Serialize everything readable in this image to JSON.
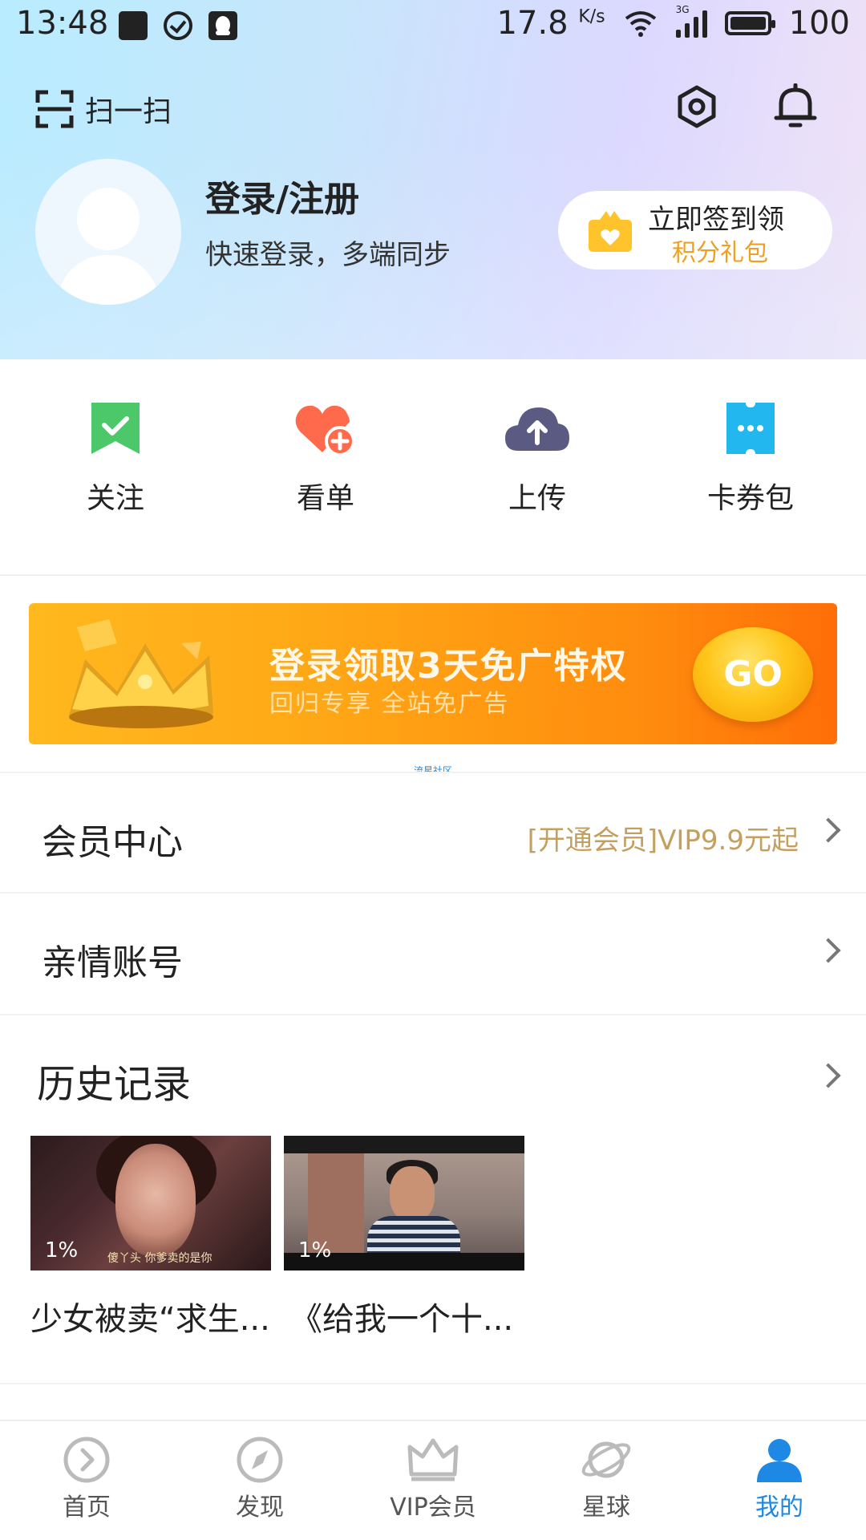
{
  "status_bar": {
    "time": "13:48",
    "speed": "17.8",
    "speed_unit": "K/s",
    "network_label": "3G",
    "battery": "100"
  },
  "header": {
    "scan_label": "扫一扫",
    "settings_icon": "settings-icon",
    "bell_icon": "bell-icon"
  },
  "profile": {
    "title": "登录/注册",
    "subtitle": "快速登录，多端同步",
    "signin_line1": "立即签到领",
    "signin_line2": "积分礼包"
  },
  "actions": [
    {
      "label": "关注",
      "icon": "bookmark-check-icon",
      "color": "#4cc76a"
    },
    {
      "label": "看单",
      "icon": "heart-plus-icon",
      "color": "#ff6a4d"
    },
    {
      "label": "上传",
      "icon": "cloud-upload-icon",
      "color": "#5b5a82"
    },
    {
      "label": "卡券包",
      "icon": "ticket-icon",
      "color": "#22b7ee"
    }
  ],
  "banner": {
    "title": "登录领取3天免广特权",
    "subtitle": "回归专享 全站免广告",
    "button": "GO",
    "credit": "流星社区"
  },
  "rows": [
    {
      "title": "会员中心",
      "extra": "[开通会员]VIP9.9元起"
    },
    {
      "title": "亲情账号",
      "extra": ""
    }
  ],
  "history": {
    "title": "历史记录",
    "items": [
      {
        "title": "少女被卖“求生...",
        "progress": "1%",
        "caption": "傻丫头 你爹卖的是你"
      },
      {
        "title": "《给我一个十...",
        "progress": "1%",
        "caption": ""
      }
    ]
  },
  "tabs": [
    {
      "label": "首页",
      "icon": "play-circle-icon",
      "active": false
    },
    {
      "label": "发现",
      "icon": "compass-icon",
      "active": false
    },
    {
      "label": "VIP会员",
      "icon": "crown-icon",
      "active": false
    },
    {
      "label": "星球",
      "icon": "planet-icon",
      "active": false
    },
    {
      "label": "我的",
      "icon": "person-icon",
      "active": true
    }
  ],
  "colors": {
    "accent": "#1e88e5",
    "gold_text": "#c4a060",
    "orange_text": "#f0a020"
  }
}
